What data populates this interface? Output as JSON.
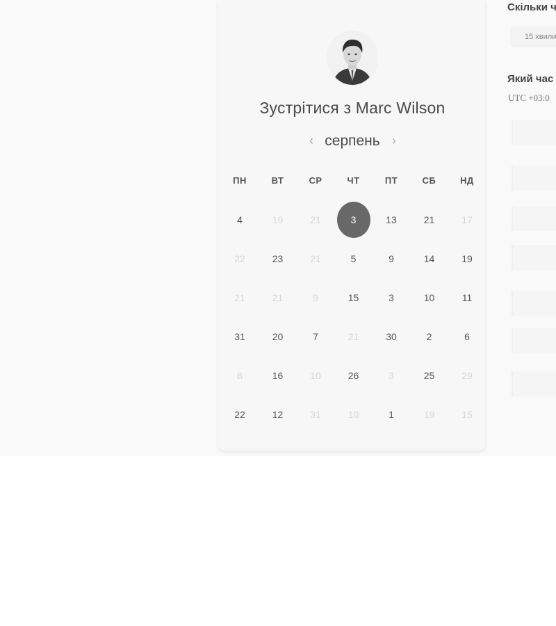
{
  "booking": {
    "title": "Зустрітися з Marc Wilson",
    "month": "серпень",
    "nav": {
      "prev": "‹",
      "next": "›"
    },
    "weekdays": [
      "ПН",
      "ВТ",
      "СР",
      "ЧТ",
      "ПТ",
      "СБ",
      "НД"
    ],
    "weeks": [
      [
        {
          "d": "4",
          "s": "normal"
        },
        {
          "d": "19",
          "s": "muted"
        },
        {
          "d": "21",
          "s": "muted"
        },
        {
          "d": "3",
          "s": "selected"
        },
        {
          "d": "13",
          "s": "normal"
        },
        {
          "d": "21",
          "s": "normal"
        },
        {
          "d": "17",
          "s": "muted"
        }
      ],
      [
        {
          "d": "22",
          "s": "muted"
        },
        {
          "d": "23",
          "s": "normal"
        },
        {
          "d": "21",
          "s": "muted"
        },
        {
          "d": "5",
          "s": "normal"
        },
        {
          "d": "9",
          "s": "normal"
        },
        {
          "d": "14",
          "s": "normal"
        },
        {
          "d": "19",
          "s": "normal"
        }
      ],
      [
        {
          "d": "21",
          "s": "muted"
        },
        {
          "d": "21",
          "s": "muted"
        },
        {
          "d": "9",
          "s": "muted"
        },
        {
          "d": "15",
          "s": "normal"
        },
        {
          "d": "3",
          "s": "normal"
        },
        {
          "d": "10",
          "s": "normal"
        },
        {
          "d": "11",
          "s": "normal"
        }
      ],
      [
        {
          "d": "31",
          "s": "normal"
        },
        {
          "d": "20",
          "s": "normal"
        },
        {
          "d": "7",
          "s": "normal"
        },
        {
          "d": "21",
          "s": "muted"
        },
        {
          "d": "30",
          "s": "normal"
        },
        {
          "d": "2",
          "s": "normal"
        },
        {
          "d": "6",
          "s": "normal"
        }
      ],
      [
        {
          "d": "8",
          "s": "muted"
        },
        {
          "d": "16",
          "s": "normal"
        },
        {
          "d": "10",
          "s": "muted"
        },
        {
          "d": "26",
          "s": "normal"
        },
        {
          "d": "3",
          "s": "muted"
        },
        {
          "d": "25",
          "s": "normal"
        },
        {
          "d": "29",
          "s": "muted"
        }
      ],
      [
        {
          "d": "22",
          "s": "normal"
        },
        {
          "d": "12",
          "s": "normal"
        },
        {
          "d": "31",
          "s": "muted"
        },
        {
          "d": "10",
          "s": "muted"
        },
        {
          "d": "1",
          "s": "normal"
        },
        {
          "d": "19",
          "s": "muted"
        },
        {
          "d": "15",
          "s": "muted"
        }
      ]
    ]
  },
  "right_panel": {
    "duration_label": "Скільки ч",
    "duration_value": "15 хвили",
    "time_label": "Який час",
    "timezone": "UTC +03:0"
  },
  "colors": {
    "selected_day": "#686868",
    "muted_day": "#d6d6d6",
    "text": "#4a4a4a"
  }
}
